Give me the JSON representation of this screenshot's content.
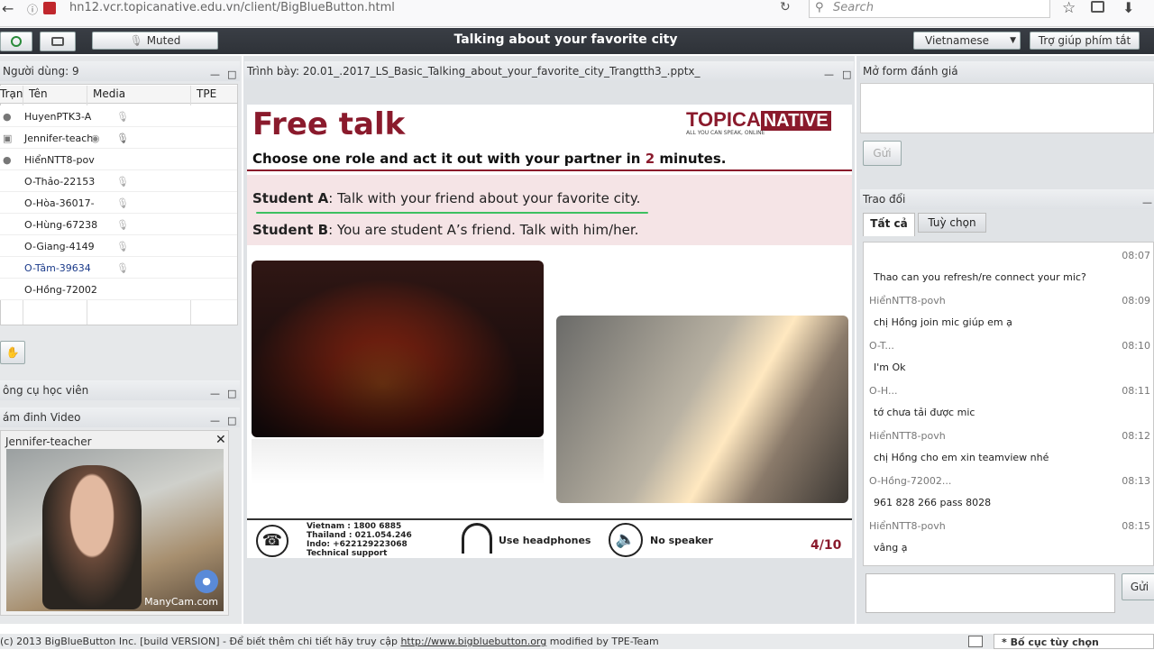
{
  "browser": {
    "url": "hn12.vcr.topicanative.edu.vn/client/BigBlueButton.html",
    "search_placeholder": "Search"
  },
  "toolbar": {
    "muted": "Muted",
    "title": "Talking about your favorite city",
    "language": "Vietnamese",
    "help": "Trợ giúp phím tắt"
  },
  "users": {
    "title": "Người dùng: 9",
    "col_status": "Trạn",
    "col_name": "Tên",
    "col_media": "Media",
    "col_tpe": "TPE",
    "rows": [
      "HuyenPTK3-A",
      "Jennifer-teach",
      "HiểnNTT8-pov",
      "O-Thảo-22153",
      "O-Hòa-36017-",
      "O-Hùng-67238",
      "O-Giang-4149",
      "O-Tâm-39634",
      "O-Hồng-72002"
    ]
  },
  "tools_title": "ông cụ học viên",
  "video_title": "ám đinh Video",
  "webcam": {
    "name": "Jennifer-teacher",
    "logo": "ManyCam.com"
  },
  "presentation": {
    "title": "Trình bày: 20.01_.2017_LS_Basic_Talking_about_your_favorite_city_Trangtth3_.pptx_"
  },
  "slide": {
    "heading": "Free talk",
    "brand_a": "TOPICA",
    "brand_b": "NATIVE",
    "brand_tag": "ALL YOU CAN SPEAK, ONLINE",
    "instruction_a": "Choose one role and act it out with your partner in ",
    "instruction_num": "2",
    "instruction_b": " minutes.",
    "student_a_label": "Student A",
    "student_a_text": ": Talk with your friend about your favorite city.",
    "student_b_label": "Student B",
    "student_b_text": ": You are student A’s friend. Talk with him/her.",
    "support_1": "Vietnam :  1800 6885",
    "support_2": "Thailand : 021.054.246",
    "support_3": "Indo:  +62212922306​8",
    "support_4": "Technical support",
    "headphones": "Use headphones",
    "no_speaker": "No speaker",
    "page": "4/10"
  },
  "eval": {
    "title": "Mở form đánh giá",
    "send": "Gửi"
  },
  "chat": {
    "title": "Trao đổi",
    "tab_all": "Tất cả",
    "tab_options": "Tuỳ chọn",
    "send": "Gửi",
    "messages": [
      {
        "who": "",
        "time": "08:07",
        "text": "Thao can you refresh/re connect your mic?"
      },
      {
        "who": "HiểnNTT8-povh",
        "time": "08:09",
        "text": "chị Hồng join mic giúp em ạ"
      },
      {
        "who": "O-T...",
        "time": "08:10",
        "text": "I'm Ok"
      },
      {
        "who": "O-H...",
        "time": "08:11",
        "text": "tớ chưa tải được mic"
      },
      {
        "who": "HiểnNTT8-povh",
        "time": "08:12",
        "text": "chị Hồng cho em xin teamview nhé"
      },
      {
        "who": "O-Hồng-72002...",
        "time": "08:13",
        "text": "961 828 266 pass 8028"
      },
      {
        "who": "HiểnNTT8-povh",
        "time": "08:15",
        "text": "vâng ạ"
      }
    ]
  },
  "footer": {
    "text": "(c) 2013 BigBlueButton Inc. [build VERSION] - Để biết thêm chi tiết hãy truy cập ",
    "link": "http://www.bigbluebutton.org",
    "suffix": " modified by TPE-Team",
    "layout": "* Bố cục tùy chọn"
  },
  "colors": {
    "brand": "#8a1a2c",
    "green_underline": "#3cc060",
    "pink_band": "#f5e4e6"
  }
}
